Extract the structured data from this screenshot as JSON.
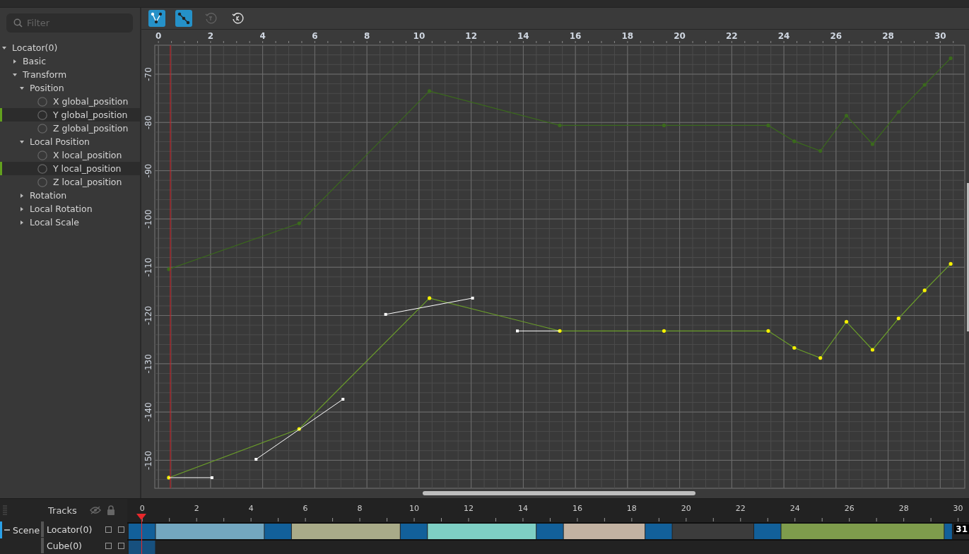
{
  "filter": {
    "placeholder": "Filter"
  },
  "tree": [
    {
      "label": "Locator(0)",
      "expanded": true,
      "children": [
        {
          "label": "Basic",
          "expanded": false
        },
        {
          "label": "Transform",
          "expanded": true,
          "children": [
            {
              "label": "Position",
              "expanded": true,
              "children": [
                {
                  "label": "X global_position",
                  "selected": false
                },
                {
                  "label": "Y global_position",
                  "selected": true
                },
                {
                  "label": "Z global_position",
                  "selected": false
                }
              ]
            },
            {
              "label": "Local Position",
              "expanded": true,
              "children": [
                {
                  "label": "X local_position",
                  "selected": false
                },
                {
                  "label": "Y local_position",
                  "selected": true
                },
                {
                  "label": "Z local_position",
                  "selected": false
                }
              ]
            },
            {
              "label": "Rotation",
              "expanded": false
            },
            {
              "label": "Local Rotation",
              "expanded": false
            },
            {
              "label": "Local Scale",
              "expanded": false
            }
          ]
        }
      ]
    }
  ],
  "toolbar": [
    {
      "kind": "broken-tangent",
      "on": true,
      "disabled": false
    },
    {
      "kind": "unified-tangent",
      "on": true,
      "disabled": false
    },
    {
      "kind": "reset-tangent",
      "on": false,
      "disabled": true
    },
    {
      "kind": "reset-key",
      "on": false,
      "disabled": false
    }
  ],
  "graph": {
    "curves": [
      {
        "active": false
      },
      {
        "active": true
      }
    ],
    "chart_data": {
      "type": "line",
      "grid": true,
      "x": [
        0.4,
        5.4,
        10.4,
        15.4,
        19.4,
        23.4,
        24.4,
        25.4,
        26.4,
        27.4,
        28.4,
        29.4,
        30.4
      ],
      "series": [
        {
          "color": "#3b6a1c",
          "values": [
            -110.4,
            -100.9,
            -73.5,
            -80.6,
            -80.6,
            -80.6,
            -83.9,
            -85.9,
            -78.6,
            -84.5,
            -77.8,
            -72.2,
            -66.7
          ]
        },
        {
          "color": "#6b9e2a",
          "values": [
            -153.6,
            -143.5,
            -116.4,
            -123.2,
            -123.2,
            -123.2,
            -126.7,
            -128.8,
            -121.3,
            -127.1,
            -120.6,
            -114.8,
            -109.3
          ]
        }
      ],
      "xlim": [
        -0.14,
        30.94
      ],
      "ylim": [
        -155.8,
        -64
      ],
      "xticks": [
        0,
        2,
        4,
        6,
        8,
        10,
        12,
        14,
        16,
        18,
        20,
        22,
        24,
        26,
        28,
        30
      ],
      "yticks": [
        -70,
        -80,
        -90,
        -100,
        -110,
        -120,
        -130,
        -140,
        -150
      ]
    }
  },
  "timeline": {
    "title": "Tracks",
    "end_frame": "31",
    "scene": {
      "label": "Scene",
      "expanded": true
    },
    "tracks": [
      {
        "hidden": false,
        "locked": false
      },
      {
        "hidden": false,
        "locked": false
      }
    ],
    "chart_data": {
      "type": "bar",
      "orientation": "horizontal",
      "stacked": true,
      "categories": [
        "Locator(0)",
        "Cube(0)"
      ],
      "series": [
        {
          "color": "#12609a",
          "values": [
            1,
            null
          ]
        },
        {
          "color": "#73a7c0",
          "values": [
            4,
            null
          ]
        },
        {
          "color": "#12609a",
          "values": [
            1,
            null
          ]
        },
        {
          "color": "#a9ab89",
          "values": [
            4,
            null
          ]
        },
        {
          "color": "#12609a",
          "values": [
            1,
            null
          ]
        },
        {
          "color": "#7ecfc4",
          "values": [
            4,
            null
          ]
        },
        {
          "color": "#12609a",
          "values": [
            1,
            null
          ]
        },
        {
          "color": "#c2b2a2",
          "values": [
            3,
            null
          ]
        },
        {
          "color": "#12609a",
          "values": [
            1,
            null
          ]
        },
        {
          "color": "#3c3c3c",
          "values": [
            3,
            null
          ]
        },
        {
          "color": "#12609a",
          "values": [
            1,
            null
          ]
        },
        {
          "color": "#7e9c4c",
          "values": [
            6,
            null
          ]
        },
        {
          "color": "#12609a",
          "values": [
            0.3,
            null
          ]
        },
        {
          "color": "#17507e",
          "values": [
            null,
            1
          ]
        }
      ],
      "xlim": [
        0,
        30.9
      ],
      "xticks": [
        {
          "value": 0.5,
          "label": "0"
        },
        {
          "value": 2.5,
          "label": "2"
        },
        {
          "value": 4.5,
          "label": "4"
        },
        {
          "value": 6.5,
          "label": "6"
        },
        {
          "value": 8.5,
          "label": "8"
        },
        {
          "value": 10.5,
          "label": "10"
        },
        {
          "value": 12.5,
          "label": "12"
        },
        {
          "value": 14.5,
          "label": "14"
        },
        {
          "value": 16.5,
          "label": "16"
        },
        {
          "value": 18.5,
          "label": "18"
        },
        {
          "value": 20.5,
          "label": "20"
        },
        {
          "value": 22.5,
          "label": "22"
        },
        {
          "value": 24.5,
          "label": "24"
        },
        {
          "value": 26.5,
          "label": "26"
        },
        {
          "value": 28.5,
          "label": "28"
        },
        {
          "value": 30.5,
          "label": "30"
        }
      ]
    }
  }
}
